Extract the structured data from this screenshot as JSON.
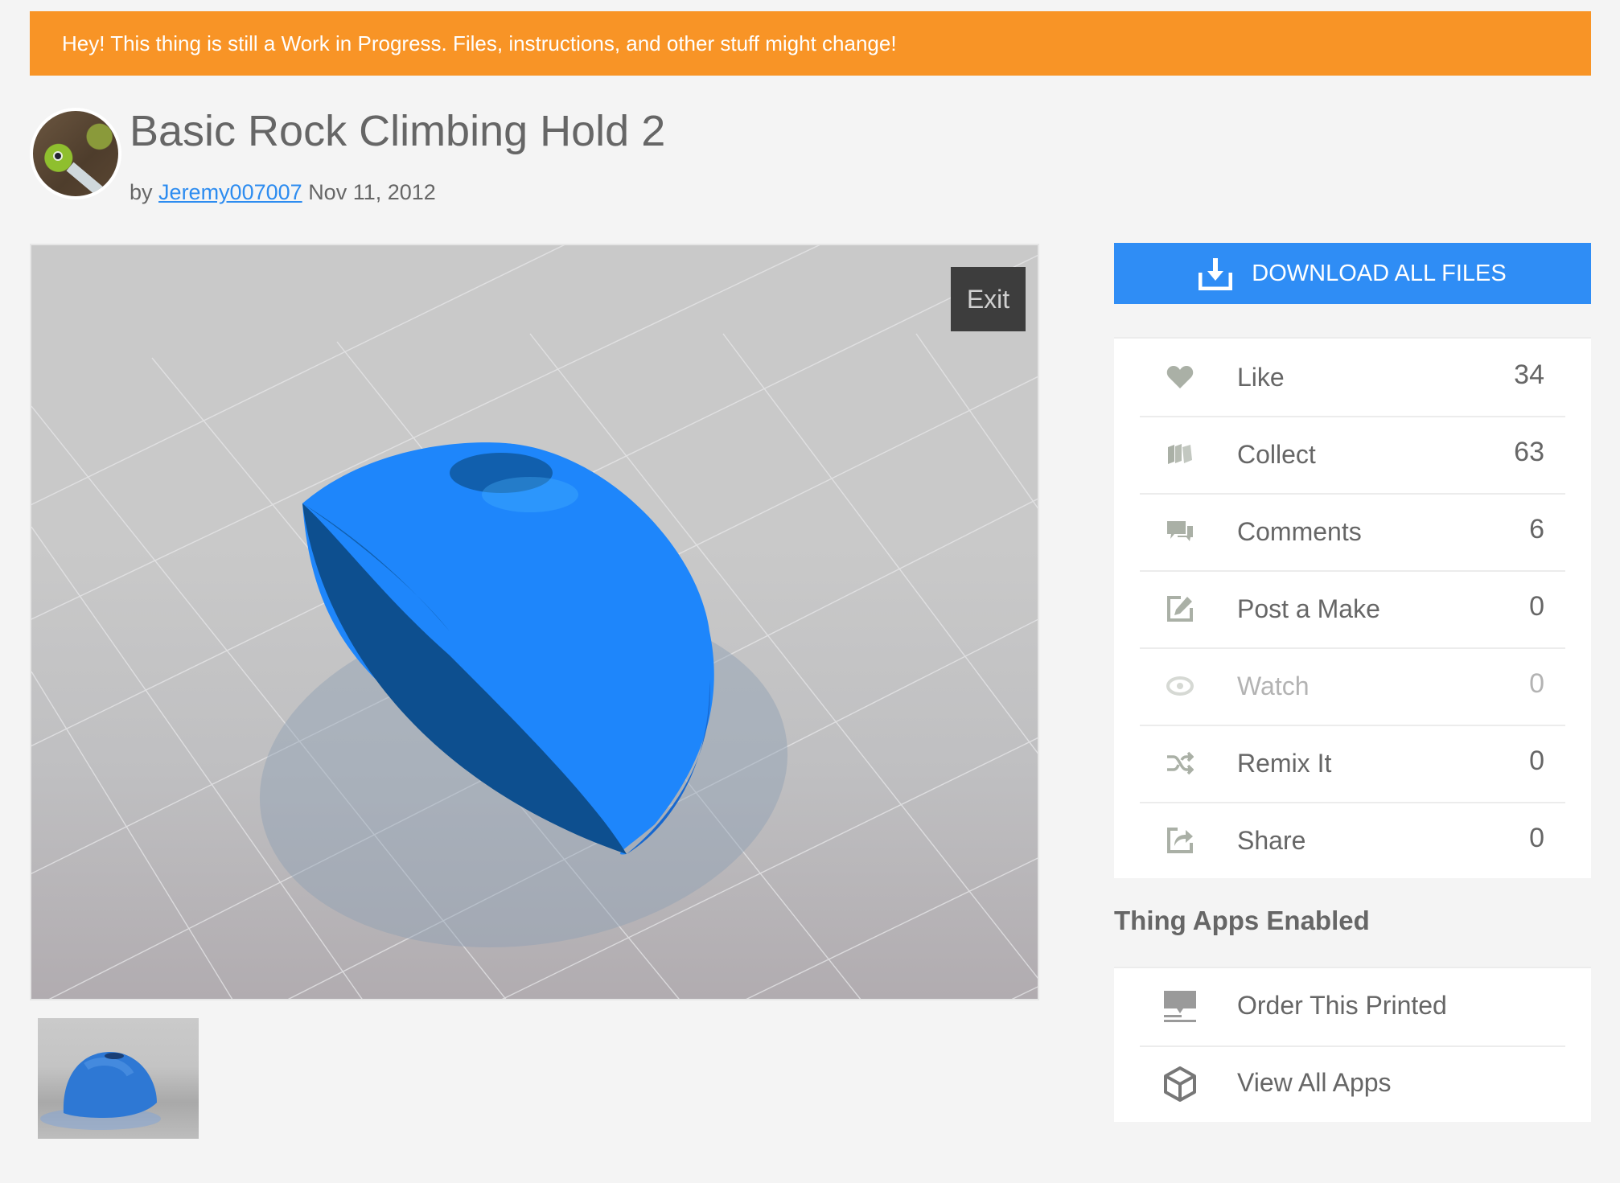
{
  "banner": {
    "text": "Hey! This thing is still a Work in Progress. Files, instructions, and other stuff might change!",
    "color": "#f89426"
  },
  "thing": {
    "title": "Basic Rock Climbing Hold 2",
    "by_label": "by",
    "author": "Jeremy007007",
    "date": "Nov 11, 2012"
  },
  "viewer": {
    "exit_label": "Exit",
    "model_color": "#1e86fb"
  },
  "thumbnails": [
    {
      "name": "thumbnail-1",
      "icon": "hold-render"
    }
  ],
  "download": {
    "label": "DOWNLOAD ALL FILES",
    "icon": "download-icon",
    "color": "#2f8df5"
  },
  "stats": [
    {
      "label": "Like",
      "count": "34",
      "icon": "heart-icon",
      "muted": false
    },
    {
      "label": "Collect",
      "count": "63",
      "icon": "collect-icon",
      "muted": false
    },
    {
      "label": "Comments",
      "count": "6",
      "icon": "comments-icon",
      "muted": false
    },
    {
      "label": "Post a Make",
      "count": "0",
      "icon": "post-make-icon",
      "muted": false
    },
    {
      "label": "Watch",
      "count": "0",
      "icon": "eye-icon",
      "muted": true
    },
    {
      "label": "Remix It",
      "count": "0",
      "icon": "remix-icon",
      "muted": false
    },
    {
      "label": "Share",
      "count": "0",
      "icon": "share-icon",
      "muted": false
    }
  ],
  "apps": {
    "heading": "Thing Apps Enabled",
    "items": [
      {
        "label": "Order This Printed",
        "icon": "printer-icon"
      },
      {
        "label": "View All Apps",
        "icon": "cube-icon"
      }
    ]
  }
}
